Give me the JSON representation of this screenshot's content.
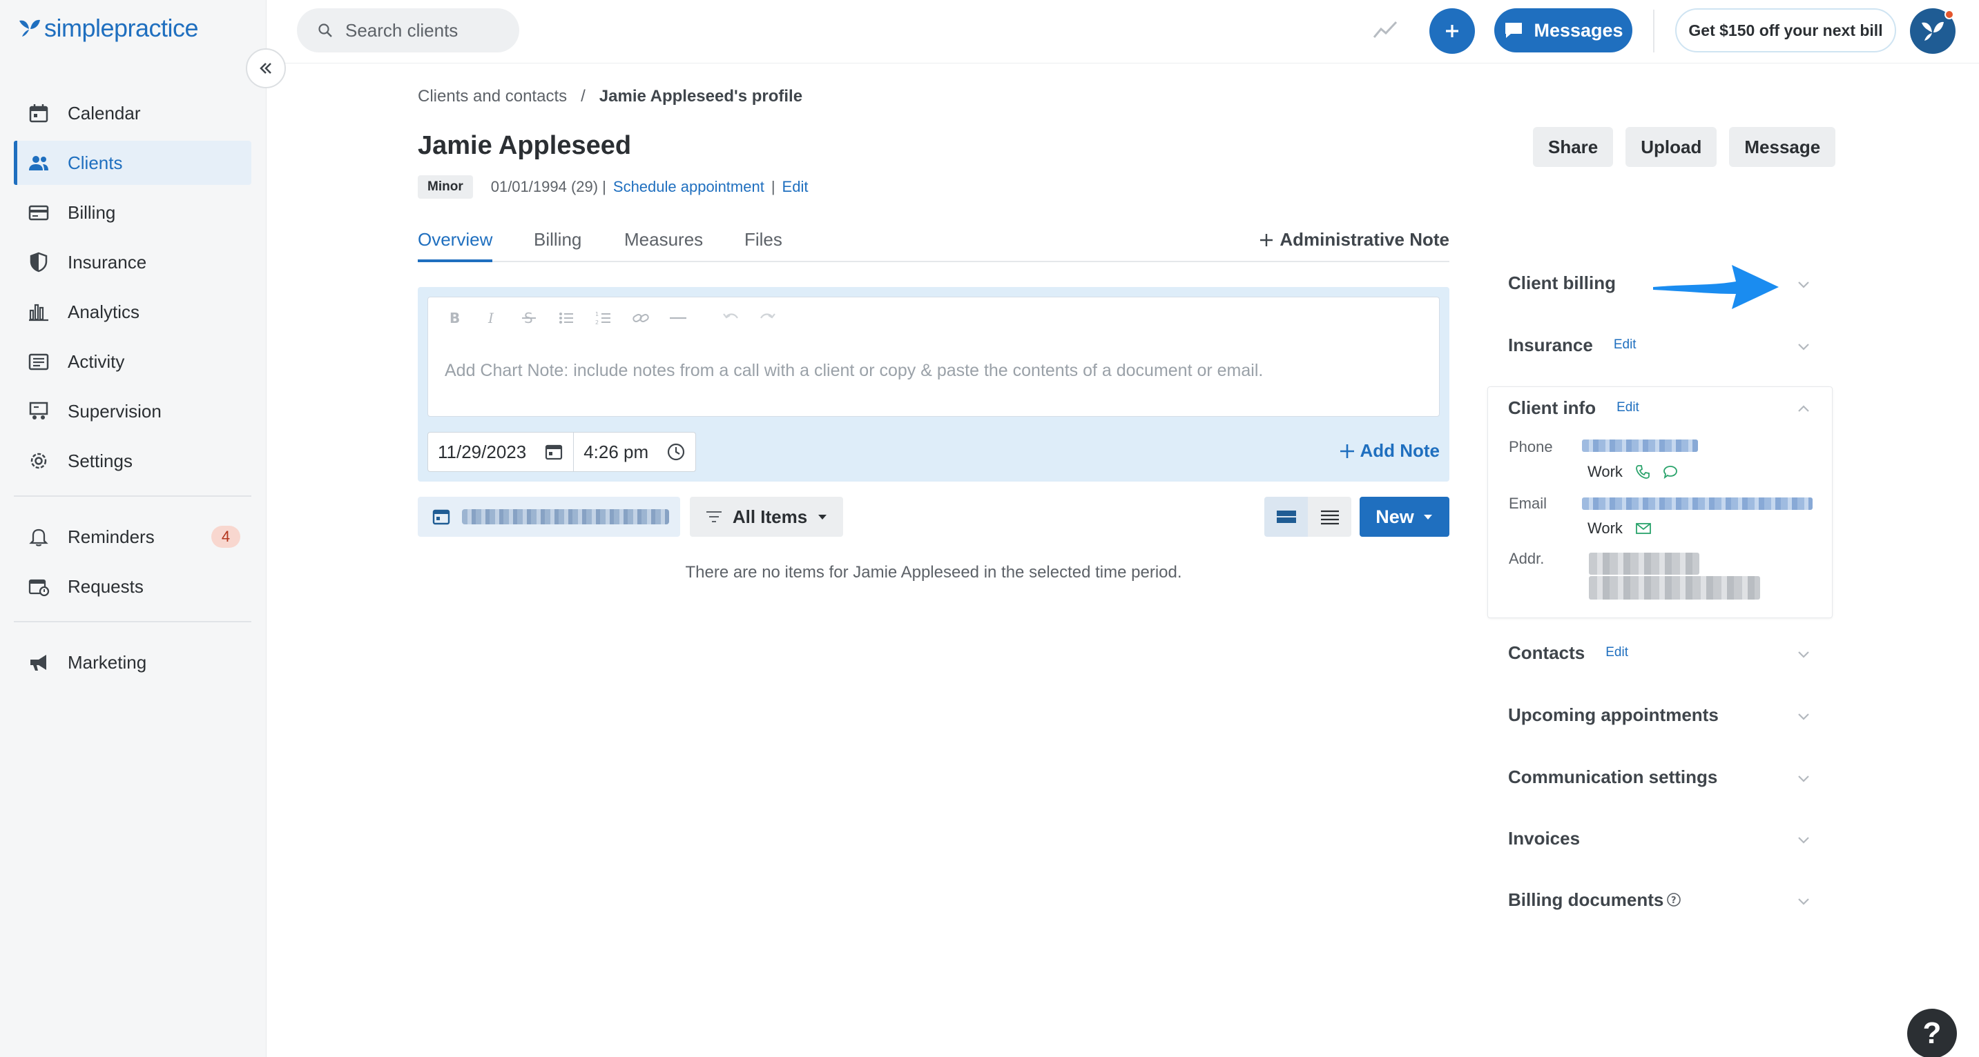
{
  "app": {
    "logo_text": "simplepractice",
    "search_placeholder": "Search clients",
    "messages_label": "Messages",
    "promo_label": "Get $150 off your next bill",
    "help_label": "?"
  },
  "sidebar": {
    "items": [
      {
        "label": "Calendar",
        "icon": "calendar-icon"
      },
      {
        "label": "Clients",
        "icon": "clients-icon",
        "active": true
      },
      {
        "label": "Billing",
        "icon": "billing-icon"
      },
      {
        "label": "Insurance",
        "icon": "shield-icon"
      },
      {
        "label": "Analytics",
        "icon": "analytics-icon"
      },
      {
        "label": "Activity",
        "icon": "activity-icon"
      },
      {
        "label": "Supervision",
        "icon": "supervision-icon"
      },
      {
        "label": "Settings",
        "icon": "gear-icon"
      }
    ],
    "reminders": {
      "label": "Reminders",
      "count": "4"
    },
    "requests": {
      "label": "Requests"
    },
    "marketing": {
      "label": "Marketing"
    }
  },
  "breadcrumb": {
    "parent": "Clients and contacts",
    "separator": "/",
    "current": "Jamie Appleseed's profile"
  },
  "client": {
    "name": "Jamie Appleseed",
    "tag": "Minor",
    "dob": "01/01/1994 (29) |",
    "schedule_link": "Schedule appointment",
    "pipe": "|",
    "edit_link": "Edit"
  },
  "actions": {
    "share": "Share",
    "upload": "Upload",
    "message": "Message"
  },
  "tabs": {
    "overview": "Overview",
    "billing": "Billing",
    "measures": "Measures",
    "files": "Files",
    "admin_note": "Administrative Note"
  },
  "note": {
    "placeholder": "Add Chart Note: include notes from a call with a client or copy & paste the contents of a document or email.",
    "date": "11/29/2023",
    "time": "4:26 pm",
    "add_note": "Add Note"
  },
  "filters": {
    "all_items": "All Items",
    "new_label": "New"
  },
  "empty_message": "There are no items for Jamie Appleseed in the selected time period.",
  "right_panel": {
    "client_billing": "Client billing",
    "insurance": "Insurance",
    "insurance_edit": "Edit",
    "client_info": "Client info",
    "client_info_edit": "Edit",
    "phone_label": "Phone",
    "phone_type": "Work",
    "email_label": "Email",
    "email_type": "Work",
    "addr_label": "Addr.",
    "contacts": "Contacts",
    "contacts_edit": "Edit",
    "upcoming": "Upcoming appointments",
    "communication": "Communication settings",
    "invoices": "Invoices",
    "billing_docs": "Billing documents"
  },
  "colors": {
    "brand": "#1f6fbf",
    "arrow": "#1a8cf0",
    "badge_bg": "#f8d7cf"
  }
}
